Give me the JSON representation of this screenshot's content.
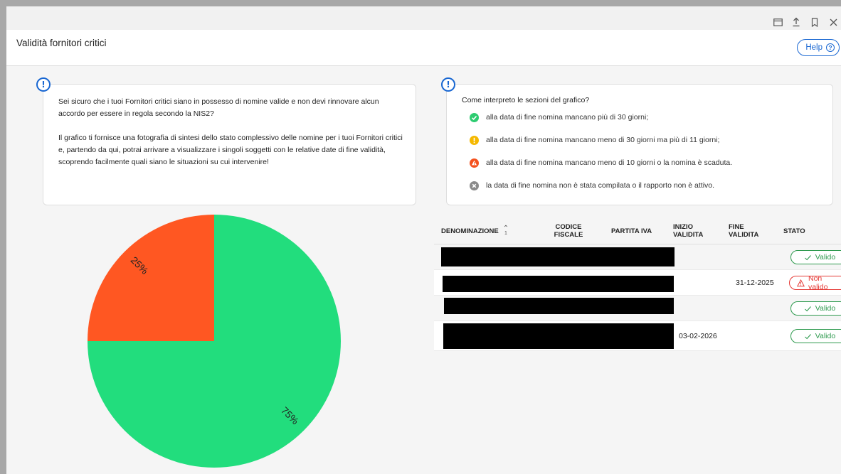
{
  "window": {
    "controls": [
      "window-icon",
      "upload-icon",
      "bookmark-icon",
      "close-icon"
    ]
  },
  "header": {
    "title": "Validità fornitori critici",
    "help_label": "Help"
  },
  "intro_card": {
    "paragraph1": "Sei sicuro che i tuoi Fornitori critici siano in possesso di nomine valide e non devi rinnovare alcun accordo per essere in regola secondo la NIS2?",
    "paragraph2": "Il grafico ti fornisce una fotografia di sintesi dello stato complessivo delle nomine per i tuoi Fornitori critici e, partendo da qui, potrai arrivare a visualizzare i singoli soggetti con le relative date di fine validità, scoprendo facilmente quali siano le situazioni su cui intervenire!"
  },
  "legend_card": {
    "title": "Come interpreto le sezioni del grafico?",
    "items": [
      {
        "icon": "check-circle-icon",
        "color": "#2ecc71",
        "text": "alla data di fine nomina mancano più di 30 giorni;"
      },
      {
        "icon": "exclamation-circle-icon",
        "color": "#f5b800",
        "text": "alla data di fine nomina mancano meno di 30 giorni ma più di 11 giorni;"
      },
      {
        "icon": "warning-circle-icon",
        "color": "#f4511e",
        "text": "alla data di fine nomina mancano meno di 10 giorni o la nomina è scaduta."
      },
      {
        "icon": "x-circle-icon",
        "color": "#8a8a8a",
        "text": "la data di fine nomina non è stata compilata o il rapporto non è attivo."
      }
    ]
  },
  "chart_data": {
    "type": "pie",
    "slices": [
      {
        "label": "75%",
        "value": 75,
        "color": "#22dd7d"
      },
      {
        "label": "25%",
        "value": 25,
        "color": "#ff5722"
      }
    ]
  },
  "table": {
    "columns": [
      {
        "label": "DENOMINAZIONE",
        "sortable": true
      },
      {
        "label": "CODICE FISCALE"
      },
      {
        "label": "PARTITA IVA"
      },
      {
        "label": "INIZIO VALIDITA"
      },
      {
        "label": "FINE VALIDITA"
      },
      {
        "label": "STATO"
      }
    ],
    "sort_indicator": "1",
    "rows": [
      {
        "inizio": "",
        "fine": "",
        "stato": "Valido",
        "status_type": "ok"
      },
      {
        "inizio": "",
        "fine": "31-12-2025",
        "stato": "Non valido",
        "status_type": "ko"
      },
      {
        "inizio": "",
        "fine": "",
        "stato": "Valido",
        "status_type": "ok"
      },
      {
        "inizio": "03-02-2026",
        "fine": "",
        "stato": "Valido",
        "status_type": "ok"
      }
    ]
  }
}
